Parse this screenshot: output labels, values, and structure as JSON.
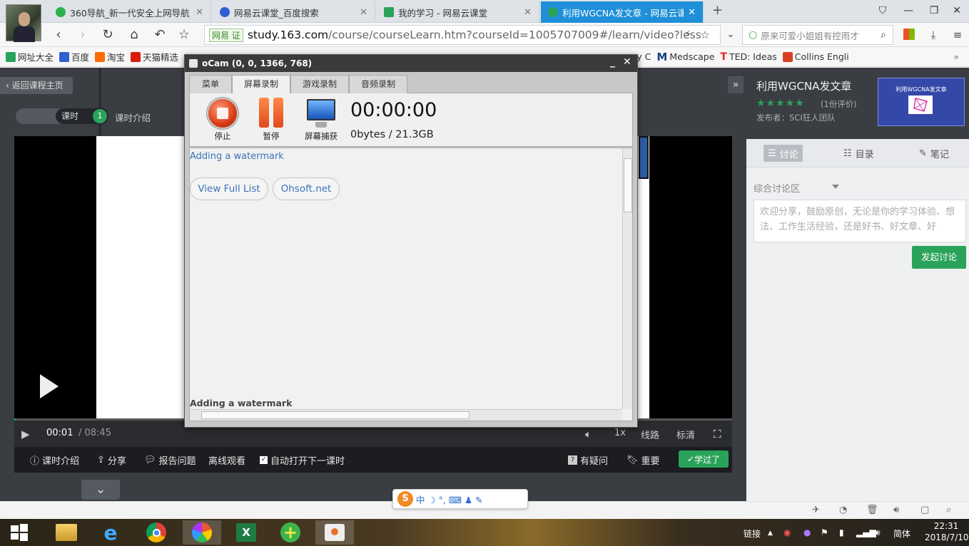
{
  "browser": {
    "tabs": [
      {
        "title": "360导航_新一代安全上网导航",
        "color": "#2bb24c"
      },
      {
        "title": "网易云课堂_百度搜索",
        "color": "#2f5fd0"
      },
      {
        "title": "我的学习 - 网易云课堂",
        "color": "#2aa35a"
      },
      {
        "title": "利用WGCNA发文章 - 网易云课",
        "color": "#2aa35a"
      }
    ],
    "new_tab": "+",
    "url_badge": "网易 证",
    "url_host": "study.163.com",
    "url_path": "/course/courseLearn.htm?courseId=1005707009#/learn/video?less",
    "search_text": "原来可爱小姐姐有控雨才",
    "bookmarks": [
      {
        "label": "网址大全",
        "color": "#2aa35a"
      },
      {
        "label": "百度",
        "color": "#2f5fd0"
      },
      {
        "label": "淘宝",
        "color": "#ff6a00"
      },
      {
        "label": "天猫精选",
        "color": "#d81e06"
      },
      {
        "label": "sey C",
        "color": "#888888"
      },
      {
        "label": "Medscape",
        "color": "#1a3f8a"
      },
      {
        "label": "TED: Ideas",
        "color": "#e62b1e"
      },
      {
        "label": "Collins Engli",
        "color": "#d94022"
      }
    ],
    "bookmarks_more": "»"
  },
  "course_page": {
    "back_label": "返回课程主页",
    "lesson_tab": "课时",
    "lesson_num": "1",
    "intro_tab": "课时介绍",
    "current_time": "00:01",
    "duration": "/ 08:45",
    "progress": 0.002,
    "speed": "1x",
    "line": "线路",
    "quality": "标清",
    "bottom": {
      "lesson_intro": "课时介绍",
      "share": "分享",
      "report": "报告问题",
      "offline": "离线观看",
      "autoplay": "自动打开下一课时",
      "question": "有疑问",
      "important": "重要",
      "learned": "学过了"
    }
  },
  "right_panel": {
    "course_title": "利用WGCNA发文章",
    "stars": "★★★★★",
    "rating": "(1份评价)",
    "publisher": "发布者：SCI狂人团队",
    "cover_text": "利用WGCNA发文章",
    "tabs": {
      "discuss": "讨论",
      "catalog": "目录",
      "notes": "笔记"
    },
    "discussion_area": "综合讨论区",
    "placeholder": "欢迎分享，鼓励原创，无论是你的学习体验、想法、工作生活经验，还是好书、好文章、好",
    "post_button": "发起讨论"
  },
  "ocam": {
    "title": "oCam (0, 0, 1366, 768)",
    "tabs": [
      "菜单",
      "屏幕录制",
      "游戏录制",
      "音频录制"
    ],
    "stop": "停止",
    "pause": "暂停",
    "capture": "屏幕捕获",
    "timer": "00:00:00",
    "size": "0bytes / 21.3GB",
    "watermark_link": "Adding a watermark",
    "view_full_list": "View Full List",
    "ohsoft": "Ohsoft.net",
    "watermark_footer": "Adding a watermark"
  },
  "ime": {
    "chars": "中 ☽ °, ⌨ ♟ ✎"
  },
  "taskbar": {
    "tray_link": "链接",
    "tray_lang": "简体",
    "time": "22:31",
    "date": "2018/7/10"
  }
}
